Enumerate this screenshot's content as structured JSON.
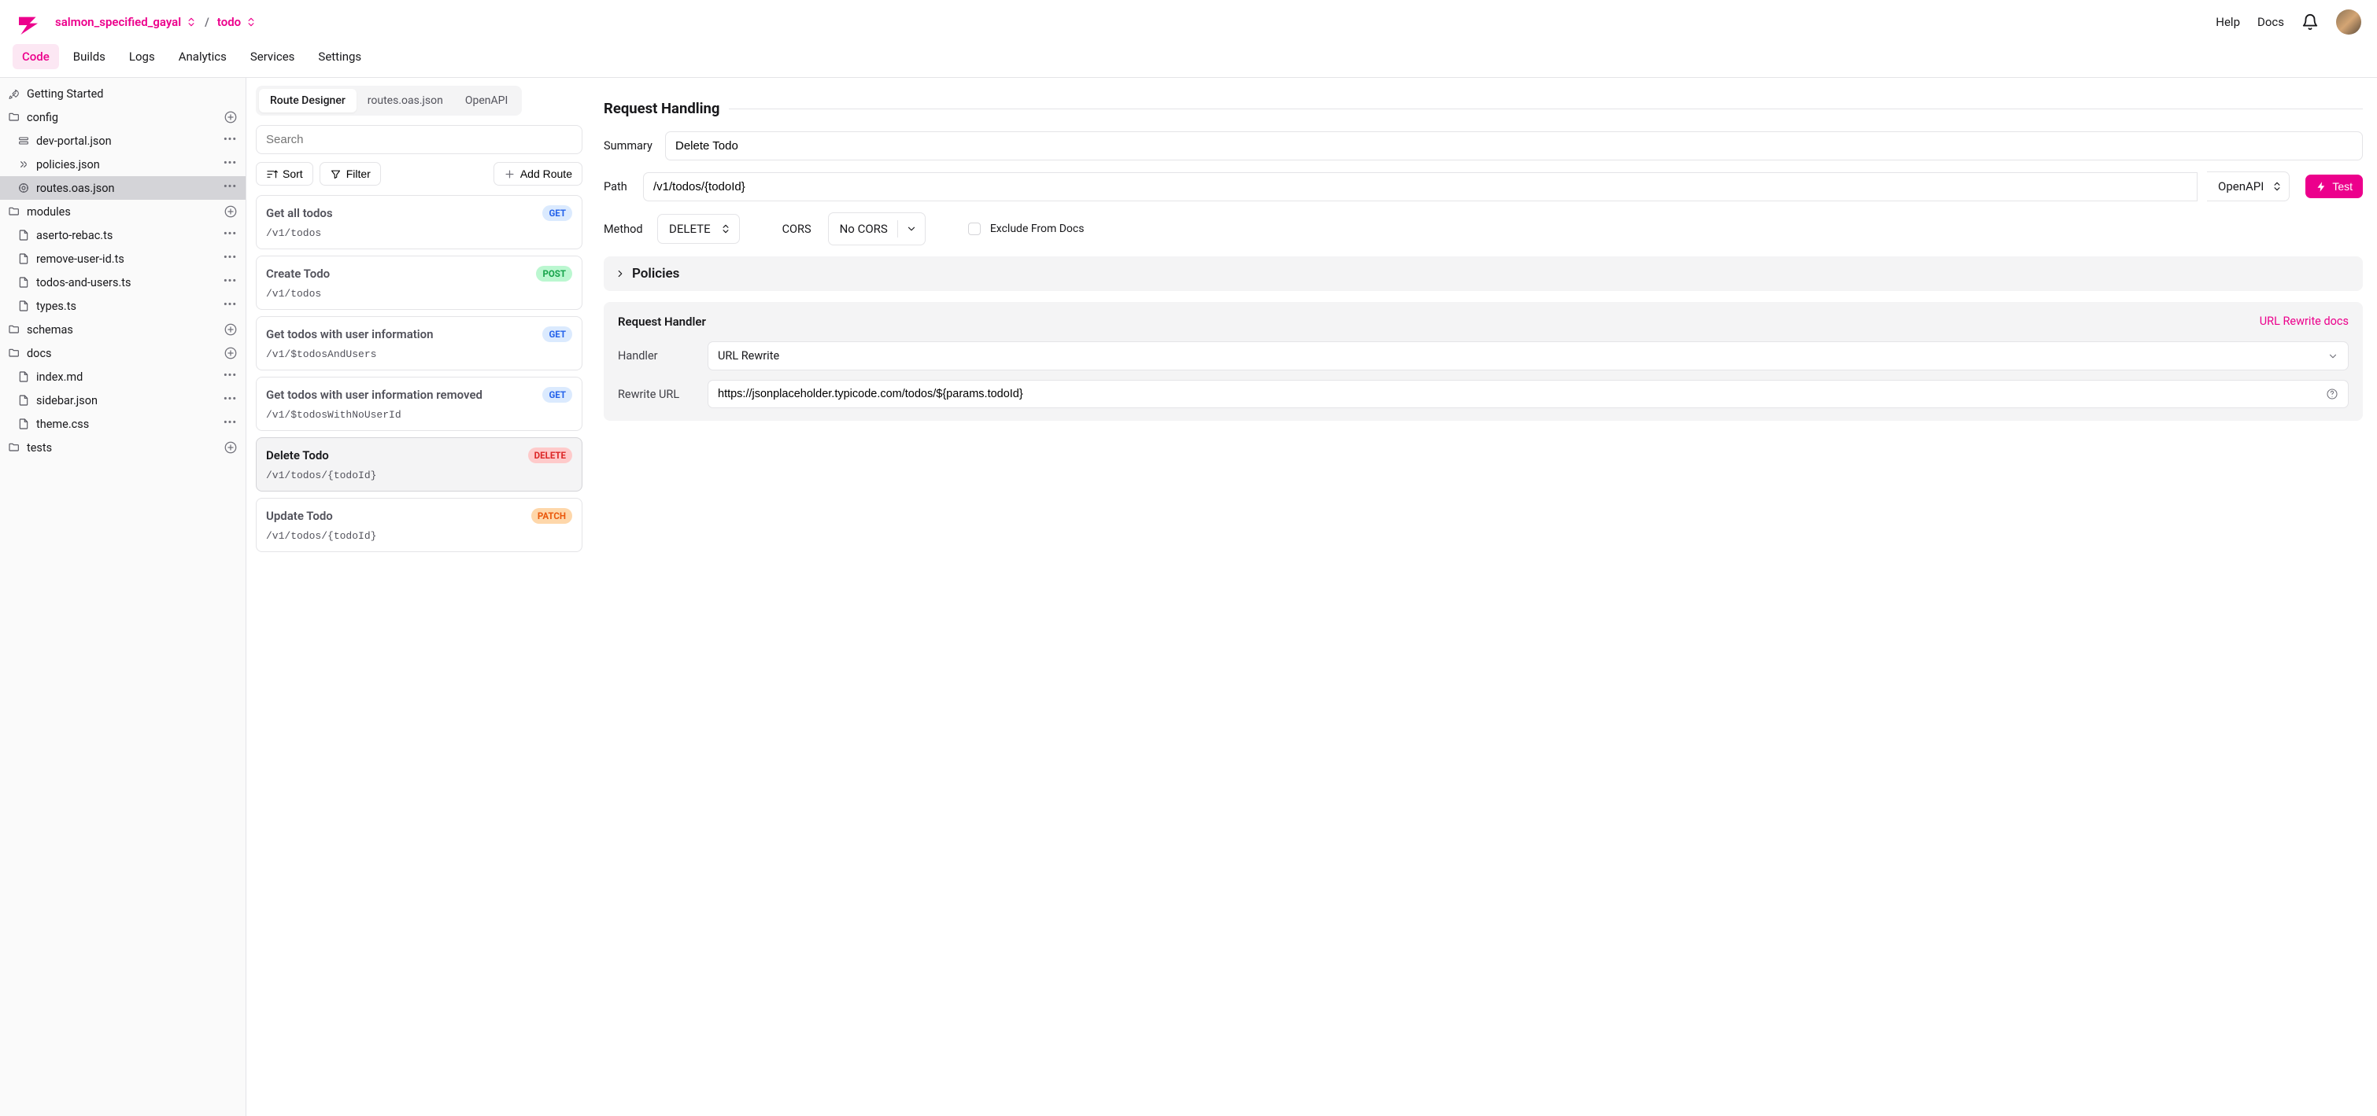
{
  "header": {
    "project": "salmon_specified_gayal",
    "environment": "todo",
    "links": {
      "help": "Help",
      "docs": "Docs"
    }
  },
  "nav": {
    "tabs": [
      "Code",
      "Builds",
      "Logs",
      "Analytics",
      "Services",
      "Settings"
    ],
    "active": "Code"
  },
  "sidebar": {
    "getting_started": "Getting Started",
    "items": [
      {
        "label": "config",
        "type": "folder",
        "action": "plus"
      },
      {
        "label": "dev-portal.json",
        "type": "cfg",
        "nested": true,
        "action": "dots"
      },
      {
        "label": "policies.json",
        "type": "policies",
        "nested": true,
        "action": "dots"
      },
      {
        "label": "routes.oas.json",
        "type": "routes",
        "nested": true,
        "action": "dots",
        "active": true
      },
      {
        "label": "modules",
        "type": "folder",
        "action": "plus"
      },
      {
        "label": "aserto-rebac.ts",
        "type": "file",
        "nested": true,
        "action": "dots"
      },
      {
        "label": "remove-user-id.ts",
        "type": "file",
        "nested": true,
        "action": "dots"
      },
      {
        "label": "todos-and-users.ts",
        "type": "file",
        "nested": true,
        "action": "dots"
      },
      {
        "label": "types.ts",
        "type": "file",
        "nested": true,
        "action": "dots"
      },
      {
        "label": "schemas",
        "type": "folder",
        "action": "plus"
      },
      {
        "label": "docs",
        "type": "folder",
        "action": "plus"
      },
      {
        "label": "index.md",
        "type": "file",
        "nested": true,
        "action": "dots"
      },
      {
        "label": "sidebar.json",
        "type": "file",
        "nested": true,
        "action": "dots"
      },
      {
        "label": "theme.css",
        "type": "file",
        "nested": true,
        "action": "dots"
      },
      {
        "label": "tests",
        "type": "folder",
        "action": "plus"
      }
    ]
  },
  "pillTabs": [
    "Route Designer",
    "routes.oas.json",
    "OpenAPI"
  ],
  "pillActive": "Route Designer",
  "search": {
    "placeholder": "Search"
  },
  "toolbar": {
    "sort": "Sort",
    "filter": "Filter",
    "add": "Add Route"
  },
  "routes": [
    {
      "title": "Get all todos",
      "path": "/v1/todos",
      "method": "GET",
      "mclass": "m-get"
    },
    {
      "title": "Create Todo",
      "path": "/v1/todos",
      "method": "POST",
      "mclass": "m-post"
    },
    {
      "title": "Get todos with user information",
      "path": "/v1/$todosAndUsers",
      "method": "GET",
      "mclass": "m-get"
    },
    {
      "title": "Get todos with user information removed",
      "path": "/v1/$todosWithNoUserId",
      "method": "GET",
      "mclass": "m-get"
    },
    {
      "title": "Delete Todo",
      "path": "/v1/todos/{todoId}",
      "method": "DELETE",
      "mclass": "m-delete",
      "active": true
    },
    {
      "title": "Update Todo",
      "path": "/v1/todos/{todoId}",
      "method": "PATCH",
      "mclass": "m-patch"
    }
  ],
  "detail": {
    "section": "Request Handling",
    "summary_label": "Summary",
    "summary_value": "Delete Todo",
    "path_label": "Path",
    "path_value": "/v1/todos/{todoId}",
    "openapi": "OpenAPI",
    "test": "Test",
    "method_label": "Method",
    "method_value": "DELETE",
    "cors_label": "CORS",
    "cors_value": "No CORS",
    "exclude_label": "Exclude From Docs",
    "policies": "Policies",
    "handler": {
      "title": "Request Handler",
      "docs_link": "URL Rewrite docs",
      "handler_label": "Handler",
      "handler_value": "URL Rewrite",
      "url_label": "Rewrite URL",
      "url_value": "https://jsonplaceholder.typicode.com/todos/${params.todoId}"
    }
  }
}
